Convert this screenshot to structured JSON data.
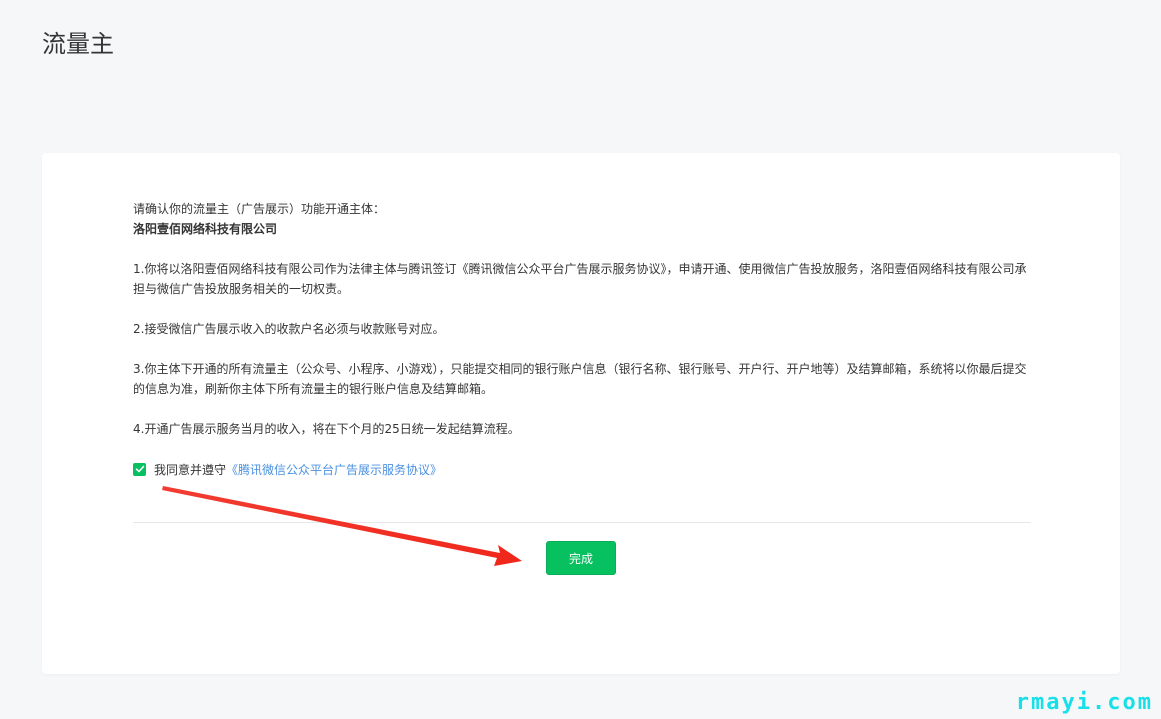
{
  "page": {
    "title": "流量主"
  },
  "agreement": {
    "intro": "请确认你的流量主（广告展示）功能开通主体：",
    "company": "洛阳壹佰网络科技有限公司",
    "clauses": [
      "1.你将以洛阳壹佰网络科技有限公司作为法律主体与腾讯签订《腾讯微信公众平台广告展示服务协议》，申请开通、使用微信广告投放服务，洛阳壹佰网络科技有限公司承担与微信广告投放服务相关的一切权责。",
      "2.接受微信广告展示收入的收款户名必须与收款账号对应。",
      "3.你主体下开通的所有流量主（公众号、小程序、小游戏），只能提交相同的银行账户信息（银行名称、银行账号、开户行、开户地等）及结算邮箱，系统将以你最后提交的信息为准，刷新你主体下所有流量主的银行账户信息及结算邮箱。",
      "4.开通广告展示服务当月的收入，将在下个月的25日统一发起结算流程。"
    ],
    "checkbox_label": "我同意并遵守",
    "checkbox_checked": true,
    "link_text": "《腾讯微信公众平台广告展示服务协议》"
  },
  "actions": {
    "done_label": "完成"
  },
  "icons": {
    "checkbox": "check-icon",
    "annotation": "red-arrow-icon"
  },
  "colors": {
    "accent": "#07c160",
    "link": "#4a90e2",
    "arrow": "#f0271b",
    "watermark": "#18e0e8"
  },
  "watermark": "rmayi.com"
}
